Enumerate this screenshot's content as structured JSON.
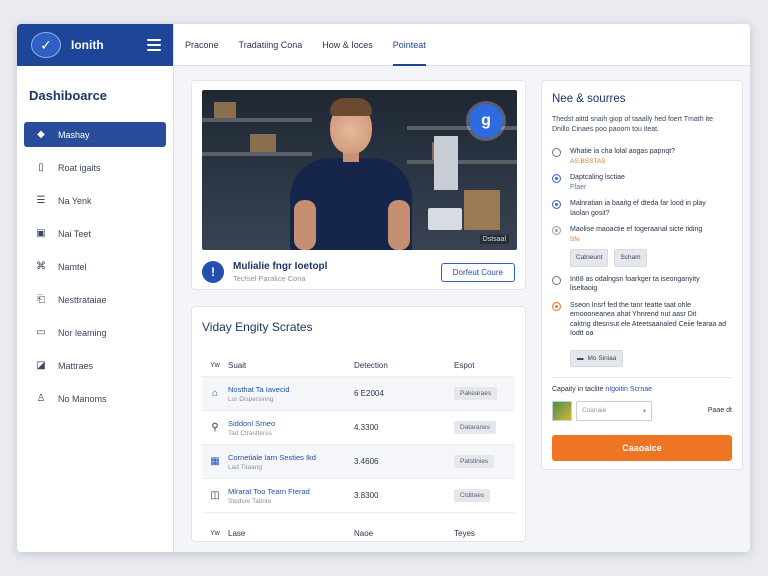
{
  "app": {
    "brand": "Ionith",
    "logo_glyph": "✓"
  },
  "sidebar": {
    "title": "Dashiboarce",
    "items": [
      {
        "label": "Mashay",
        "icon": "tag-icon",
        "glyph": "◆"
      },
      {
        "label": "Roat igaits",
        "icon": "page-icon",
        "glyph": "▯"
      },
      {
        "label": "Na Yenk",
        "icon": "list-icon",
        "glyph": "☰"
      },
      {
        "label": "Nai Teet",
        "icon": "image-icon",
        "glyph": "▣"
      },
      {
        "label": "Namtel",
        "icon": "node-icon",
        "glyph": "⌘"
      },
      {
        "label": "Nesttrataiae",
        "icon": "doc-icon",
        "glyph": "⎗"
      },
      {
        "label": "Nor leaming",
        "icon": "monitor-icon",
        "glyph": "▭"
      },
      {
        "label": "Mattraes",
        "icon": "chart-icon",
        "glyph": "◪"
      },
      {
        "label": "No Manoms",
        "icon": "user-icon",
        "glyph": "♙"
      }
    ]
  },
  "topnav": {
    "tabs": [
      "Pracone",
      "Tradatiing Cona",
      "How & Ioces",
      "Pointeat"
    ],
    "active_index": 3
  },
  "video": {
    "badge_glyph": "g",
    "watermark": "Dstsaal",
    "title": "Mulialie fngr Ioetopl",
    "subtitle": "Tecfsel Paralice Cona",
    "info_glyph": "!",
    "button": "Dorfeut Coure"
  },
  "table": {
    "title": "Viday Engity Scrates",
    "headers": [
      "Yw",
      "Suait",
      "Detection",
      "Espot"
    ],
    "rows": [
      {
        "icon": "home-icon",
        "glyph": "⌂",
        "name": "Nosthat Ta Iavecid",
        "sub": "Lor Dispersinng",
        "detection": "6 E2004",
        "export": "Pakearaes"
      },
      {
        "icon": "pin-icon",
        "glyph": "⚲",
        "name": "Siddonl Srneo",
        "sub": "Tad Ctrastterss",
        "detection": "4.3300",
        "export": "Dataranes"
      },
      {
        "icon": "grid-icon",
        "glyph": "▦",
        "name": "Cornetiale Iarn Sesties Ikd",
        "sub": "Lad Titaang",
        "detection": "3.4606",
        "export": "Patstinies"
      },
      {
        "icon": "book-icon",
        "glyph": "◫",
        "name": "Mlrarat Too Tearn Fterad",
        "sub": "Stedsre Tatinte",
        "detection": "3.8300",
        "export": "Ctdttaes"
      }
    ],
    "footer": [
      "Yw",
      "Lase",
      "Naoe",
      "Teyes"
    ]
  },
  "panel": {
    "title": "Nee & sourres",
    "desc": "Thedst aittd snaih giop of taaally hed foert Tmath ite Dnillo Cinaes poo paoom tou iteat.",
    "questions": [
      {
        "text": "Whatie ia cha lolal aogas papnqt?",
        "sub": "AS BSSTAS",
        "sub_style": "orange",
        "dot": "empty"
      },
      {
        "text": "Daptcaling lsctiae",
        "sub": "Ffaer",
        "sub_style": "gray",
        "dot": "blue"
      },
      {
        "text": "Malnratian ia baaitg ef dteda far lood in play",
        "sub": "Iaolan gosit?",
        "sub_style": "plain",
        "dot": "blue"
      },
      {
        "text": "Maolise maoactie ef togeraanal sicte tiding",
        "sub": "Sfe",
        "sub_style": "plain",
        "dot": "gray"
      },
      {
        "text": "IntI8 as odalngsn foarkger ta iseonganyity",
        "sub": "liseltaoig",
        "sub_style": "plain",
        "dot": "empty"
      },
      {
        "text": "Sseon Insrf fed the tanr teatte taat ohle emoooneanea ahat Yhnrend nut aasr Dit",
        "sub": "caktng dtesnsut ele Ateetsaanaled Ceiie fearaa ad Iodtt oa",
        "sub_style": "plain",
        "dot": "orange"
      }
    ],
    "chips": [
      "Catneunt",
      "Scham"
    ],
    "chip_dark": "Mo Siniaa",
    "capacity_label": "Capaity in taclite",
    "capacity_link": "nIgoitin Scrnae",
    "select_placeholder": "Coanaie",
    "select_right": "Paae dt",
    "cta": "Caaoaice"
  },
  "colors": {
    "brand_blue": "#1e4597",
    "accent_orange": "#ee7524",
    "accent_blue": "#2f6ae0"
  }
}
